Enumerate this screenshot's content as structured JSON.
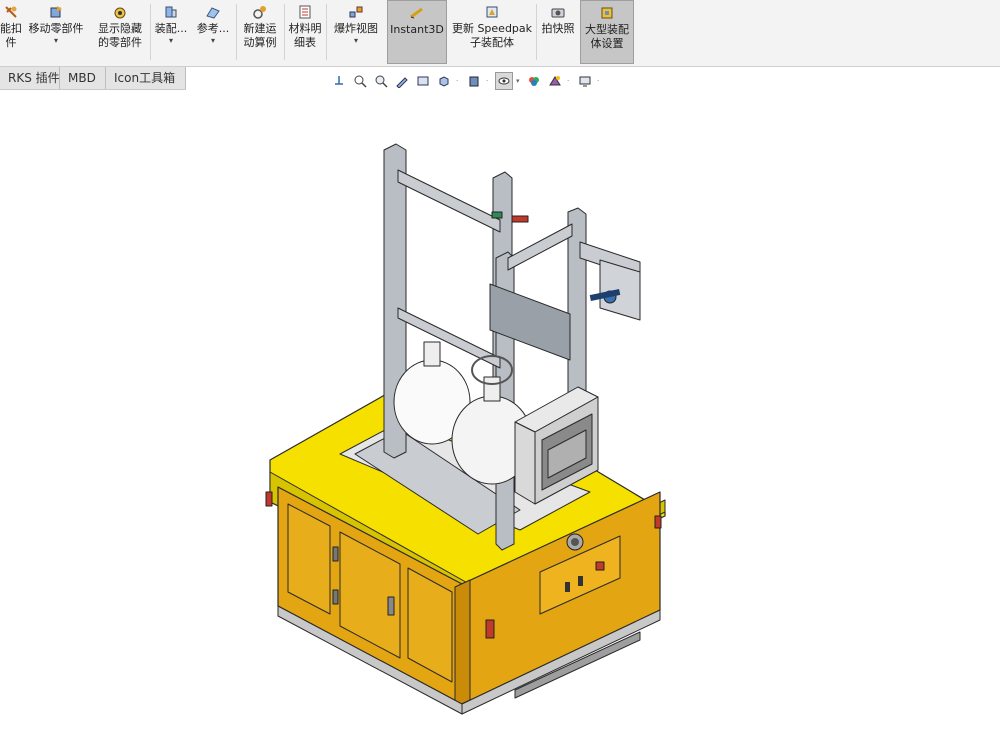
{
  "ribbon": {
    "buttons": [
      {
        "label1": "能扣",
        "label2": "件",
        "icon": "smart-fastener-icon"
      },
      {
        "label1": "移动零部件",
        "label2": "",
        "icon": "move-component-icon",
        "dropdown": "▾"
      },
      {
        "label1": "显示隐藏",
        "label2": "的零部件",
        "icon": "show-hidden-components-icon"
      },
      {
        "label1": "装配...",
        "label2": "",
        "icon": "assembly-features-icon",
        "dropdown": "▾"
      },
      {
        "label1": "参考...",
        "label2": "",
        "icon": "reference-geometry-icon",
        "dropdown": "▾"
      },
      {
        "label1": "新建运",
        "label2": "动算例",
        "icon": "new-motion-study-icon"
      },
      {
        "label1": "材料明",
        "label2": "细表",
        "icon": "bill-of-materials-icon"
      },
      {
        "label1": "爆炸视图",
        "label2": "",
        "icon": "exploded-view-icon",
        "dropdown": "▾"
      },
      {
        "label1": "Instant3D",
        "label2": "",
        "icon": "instant3d-icon"
      },
      {
        "label1": "更新 Speedpak",
        "label2": "子装配体",
        "icon": "update-speedpak-icon"
      },
      {
        "label1": "拍快照",
        "label2": "",
        "icon": "snapshot-icon"
      },
      {
        "label1": "大型装配",
        "label2": "体设置",
        "icon": "large-assembly-settings-icon"
      }
    ]
  },
  "tabs": [
    "RKS 插件",
    "MBD",
    "Icon工具箱"
  ],
  "view_toolbar": [
    "zoom-to-fit-icon",
    "zoom-area-icon",
    "previous-view-icon",
    "section-view-icon",
    "dynamic-annotation-icon",
    "view-orientation-icon",
    "display-style-icon",
    "hide-show-items-icon",
    "edit-appearance-icon",
    "apply-scene-icon",
    "view-settings-icon"
  ],
  "colors": {
    "frame_yellow": "#f5e000",
    "panel_orange": "#e3a512",
    "aluminum": "#b9bec4",
    "outline": "#2a2a2a"
  }
}
